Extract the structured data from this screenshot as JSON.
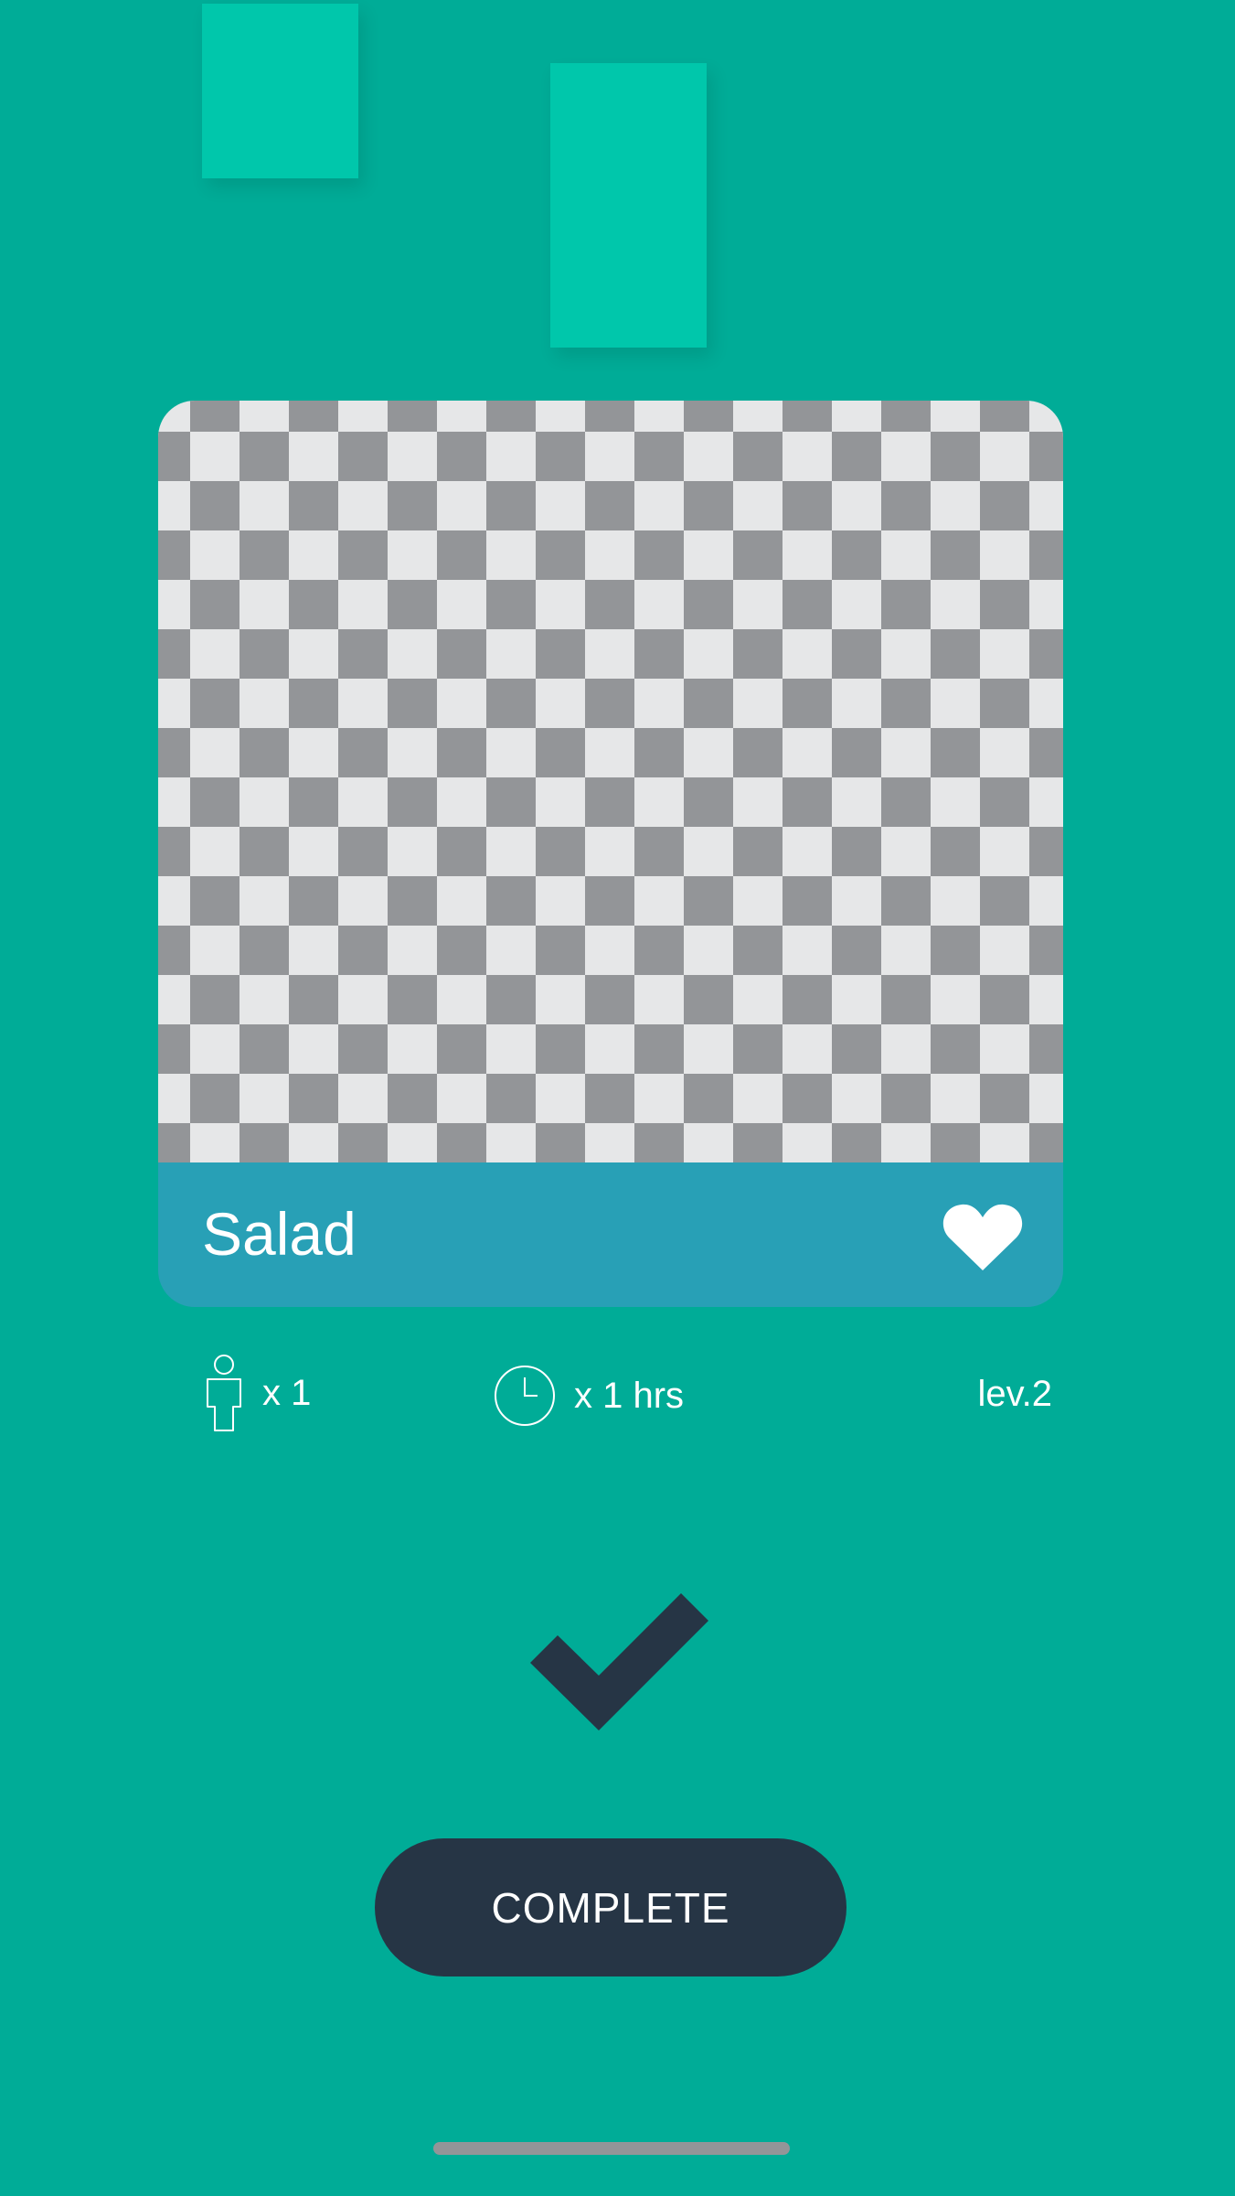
{
  "colors": {
    "background": "#00ac97",
    "decor_tile": "#00c7ab",
    "card_footer": "#28a0b6",
    "button": "#263545",
    "checkmark": "#263545",
    "checker_dark": "#939598",
    "checker_light": "#e6e7e8"
  },
  "recipe_card": {
    "image": "transparent placeholder (checkerboard)",
    "title": "Salad",
    "favorite_icon": "heart-icon"
  },
  "info": {
    "servings_icon": "person-icon",
    "servings": "x 1",
    "time_icon": "clock-icon",
    "time": "x 1 hrs",
    "level": "lev.2"
  },
  "status_icon": "checkmark-icon",
  "actions": {
    "complete_label": "COMPLETE"
  }
}
